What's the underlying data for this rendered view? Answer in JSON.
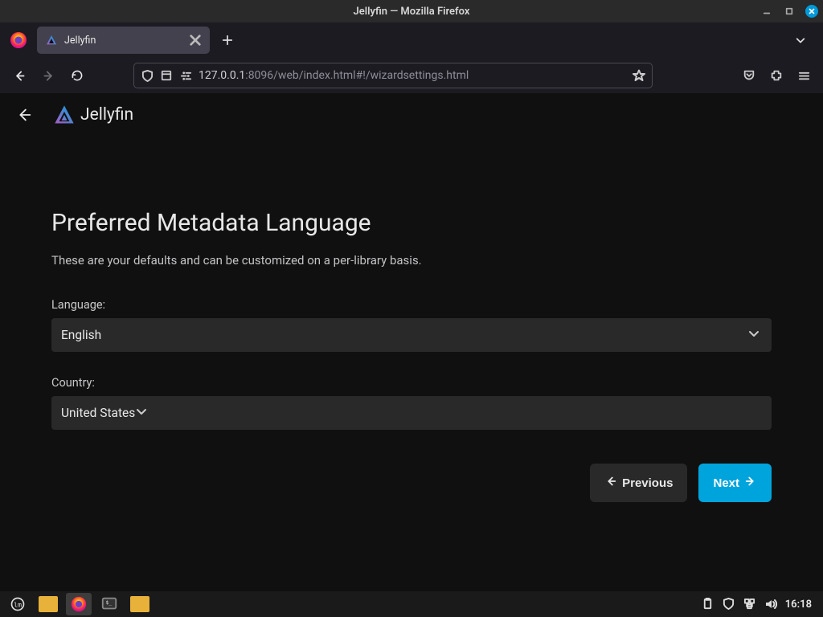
{
  "os": {
    "window_title": "Jellyfin — Mozilla Firefox",
    "clock": "16:18"
  },
  "browser": {
    "tab_title": "Jellyfin",
    "url_host": "127.0.0.1",
    "url_rest": ":8096/web/index.html#!/wizardsettings.html"
  },
  "app": {
    "name": "Jellyfin"
  },
  "wizard": {
    "title": "Preferred Metadata Language",
    "description": "These are your defaults and can be customized on a per-library basis.",
    "language_label": "Language:",
    "language_value": "English",
    "country_label": "Country:",
    "country_value": "United States",
    "previous_label": "Previous",
    "next_label": "Next"
  }
}
